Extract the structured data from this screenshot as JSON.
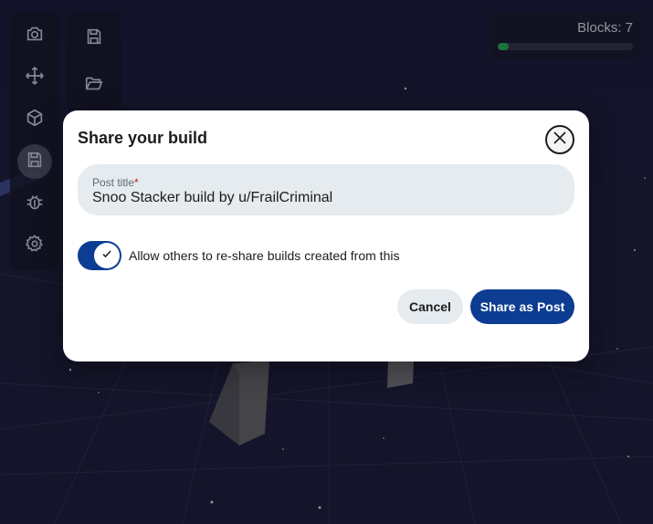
{
  "toolbar": {
    "tools": [
      {
        "icon": "camera-icon"
      },
      {
        "icon": "move-icon"
      },
      {
        "icon": "cube-icon"
      },
      {
        "icon": "save-icon",
        "active": true
      },
      {
        "icon": "bug-icon"
      },
      {
        "icon": "gear-icon"
      }
    ],
    "sub_tools": [
      {
        "icon": "save-icon"
      },
      {
        "icon": "folder-open-icon"
      }
    ]
  },
  "blocks": {
    "label": "Blocks: 7",
    "progress": 0.08,
    "bar_color": "#1e9d4a"
  },
  "modal": {
    "title": "Share your build",
    "close_icon": "close-icon",
    "post_title_label": "Post title",
    "required_marker": "*",
    "post_title_value": "Snoo Stacker build by u/FrailCriminal",
    "toggle_on": true,
    "toggle_label": "Allow others to re-share builds created from this",
    "cancel_label": "Cancel",
    "share_label": "Share as Post",
    "accent_color": "#0d3d92"
  }
}
